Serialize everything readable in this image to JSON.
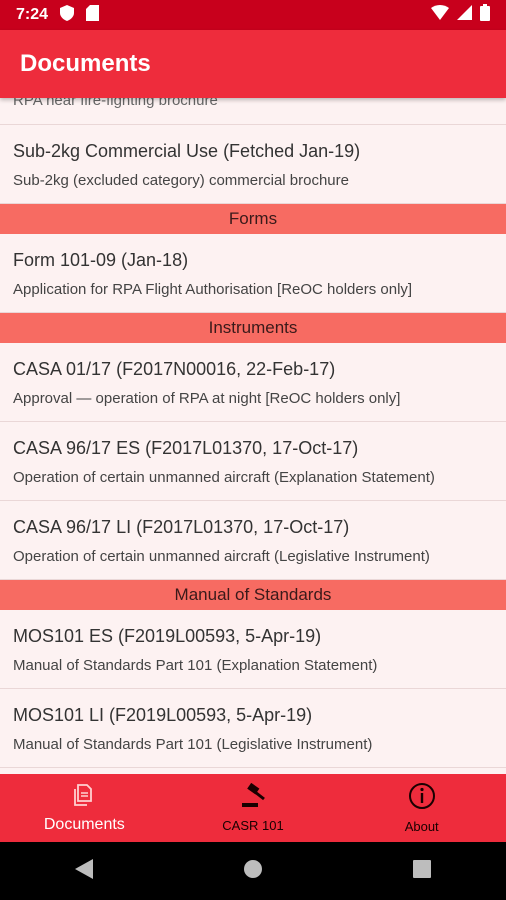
{
  "status": {
    "time": "7:24"
  },
  "appbar": {
    "title": "Documents"
  },
  "list": {
    "partial": {
      "subtitle": "RPA near fire-fighting brochure"
    },
    "items_a": [
      {
        "title": "Sub-2kg Commercial Use (Fetched Jan-19)",
        "subtitle": "Sub-2kg (excluded category) commercial brochure"
      }
    ],
    "section_forms": "Forms",
    "items_forms": [
      {
        "title": "Form 101-09 (Jan-18)",
        "subtitle": "Application for RPA Flight Authorisation [ReOC holders only]"
      }
    ],
    "section_instruments": "Instruments",
    "items_instruments": [
      {
        "title": "CASA 01/17 (F2017N00016, 22-Feb-17)",
        "subtitle": "Approval — operation of RPA at night [ReOC holders only]"
      },
      {
        "title": "CASA 96/17 ES (F2017L01370, 17-Oct-17)",
        "subtitle": "Operation of certain unmanned aircraft (Explanation Statement)"
      },
      {
        "title": "CASA 96/17 LI (F2017L01370, 17-Oct-17)",
        "subtitle": "Operation of certain unmanned aircraft (Legislative Instrument)"
      }
    ],
    "section_mos": "Manual of Standards",
    "items_mos": [
      {
        "title": "MOS101 ES (F2019L00593, 5-Apr-19)",
        "subtitle": "Manual of Standards Part 101 (Explanation Statement)"
      },
      {
        "title": "MOS101 LI (F2019L00593, 5-Apr-19)",
        "subtitle": "Manual of Standards Part 101 (Legislative Instrument)"
      }
    ]
  },
  "bottomnav": {
    "documents": "Documents",
    "casr": "CASR 101",
    "about": "About"
  },
  "colors": {
    "statusbar": "#c8001c",
    "appbar": "#ee2c3c",
    "section": "#f76b62"
  },
  "icons": [
    "shield-icon",
    "sd-card-icon",
    "wifi-icon",
    "signal-icon",
    "battery-icon",
    "documents-icon",
    "gavel-icon",
    "info-icon",
    "back-icon",
    "home-icon",
    "recents-icon"
  ]
}
